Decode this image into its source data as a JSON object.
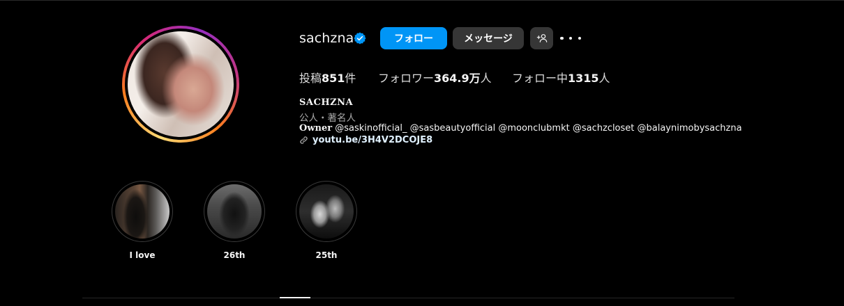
{
  "profile": {
    "username": "sachzna",
    "verified_icon": "verified-badge-icon",
    "avatar_icon": "profile-photo",
    "actions": {
      "follow_label": "フォロー",
      "message_label": "メッセージ",
      "add_user_icon": "add-person-icon",
      "more_icon": "ellipsis-icon"
    },
    "stats": {
      "posts_label": "投稿",
      "posts_value": "851",
      "posts_unit": "件",
      "followers_label": "フォロワー",
      "followers_value": "364.9万",
      "followers_unit": "人",
      "following_label": "フォロー中",
      "following_value": "1315",
      "following_unit": "人"
    },
    "bio": {
      "name": "SACHZNA",
      "category": "公人・著名人",
      "owner_label": "Owner",
      "owner_text": " @saskinofficial_ @sasbeautyofficial @moonclubmkt @sachzcloset @balaynimobysachzna",
      "link_icon": "link-icon",
      "link_text": "youtu.be/3H4V2DCOJE8"
    }
  },
  "highlights": [
    {
      "label": "I love"
    },
    {
      "label": "26th"
    },
    {
      "label": "25th"
    }
  ],
  "colors": {
    "background": "#000000",
    "follow_button": "#0095f6",
    "secondary_button": "#363636",
    "verified": "#0095f6"
  }
}
